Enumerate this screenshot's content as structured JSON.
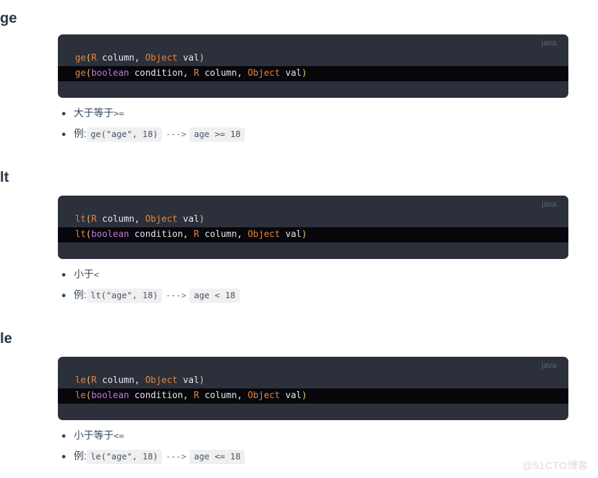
{
  "page": {
    "background": "#ffffff",
    "watermark": "@51CTO博客",
    "code_theme": {
      "block_bg": "#2b303b",
      "highlight_bg": "#07070b",
      "lang_label_color": "#5c6673",
      "fn_color": "#e8833a",
      "punct_color": "#e5c07b",
      "type_color": "#e8833a",
      "keyword_color": "#c678dd",
      "plain_color": "#e6e9ef"
    },
    "heading_color": "#243746",
    "bullet_text_color": "#34495e",
    "inline_code_bg": "#f0f0f0",
    "inline_code_color": "#44546a"
  },
  "sections": [
    {
      "heading": "ge",
      "code": {
        "lang_label": "java",
        "lines": [
          {
            "highlighted": false,
            "tokens": [
              {
                "text": "ge",
                "type": "fn"
              },
              {
                "text": "(",
                "type": "punct"
              },
              {
                "text": "R",
                "type": "type"
              },
              {
                "text": " column, ",
                "type": "plain"
              },
              {
                "text": "Object",
                "type": "type"
              },
              {
                "text": " val",
                "type": "plain"
              },
              {
                "text": ")",
                "type": "punct"
              }
            ]
          },
          {
            "highlighted": true,
            "tokens": [
              {
                "text": "ge",
                "type": "fn"
              },
              {
                "text": "(",
                "type": "punct"
              },
              {
                "text": "boolean",
                "type": "kw"
              },
              {
                "text": " condition, ",
                "type": "plain"
              },
              {
                "text": "R",
                "type": "type"
              },
              {
                "text": " column, ",
                "type": "plain"
              },
              {
                "text": "Object",
                "type": "type"
              },
              {
                "text": " val",
                "type": "plain"
              },
              {
                "text": ")",
                "type": "punct"
              }
            ]
          }
        ]
      },
      "bullets": [
        {
          "parts": [
            {
              "kind": "text",
              "text": "大于等于 "
            },
            {
              "kind": "symbol",
              "text": ">="
            }
          ]
        },
        {
          "parts": [
            {
              "kind": "text",
              "text": "例: "
            },
            {
              "kind": "code",
              "text": "ge(\"age\", 18)"
            },
            {
              "kind": "arrow",
              "text": "--->"
            },
            {
              "kind": "code",
              "text": "age >= 18"
            }
          ]
        }
      ]
    },
    {
      "heading": "lt",
      "code": {
        "lang_label": "java",
        "lines": [
          {
            "highlighted": false,
            "tokens": [
              {
                "text": "lt",
                "type": "fn"
              },
              {
                "text": "(",
                "type": "punct"
              },
              {
                "text": "R",
                "type": "type"
              },
              {
                "text": " column, ",
                "type": "plain"
              },
              {
                "text": "Object",
                "type": "type"
              },
              {
                "text": " val",
                "type": "plain"
              },
              {
                "text": ")",
                "type": "punct"
              }
            ]
          },
          {
            "highlighted": true,
            "tokens": [
              {
                "text": "lt",
                "type": "fn"
              },
              {
                "text": "(",
                "type": "punct"
              },
              {
                "text": "boolean",
                "type": "kw"
              },
              {
                "text": " condition, ",
                "type": "plain"
              },
              {
                "text": "R",
                "type": "type"
              },
              {
                "text": " column, ",
                "type": "plain"
              },
              {
                "text": "Object",
                "type": "type"
              },
              {
                "text": " val",
                "type": "plain"
              },
              {
                "text": ")",
                "type": "punct"
              }
            ]
          }
        ]
      },
      "bullets": [
        {
          "parts": [
            {
              "kind": "text",
              "text": "小于 "
            },
            {
              "kind": "symbol",
              "text": "<"
            }
          ]
        },
        {
          "parts": [
            {
              "kind": "text",
              "text": "例: "
            },
            {
              "kind": "code",
              "text": "lt(\"age\", 18)"
            },
            {
              "kind": "arrow",
              "text": "--->"
            },
            {
              "kind": "code",
              "text": "age < 18"
            }
          ]
        }
      ]
    },
    {
      "heading": "le",
      "code": {
        "lang_label": "java",
        "lines": [
          {
            "highlighted": false,
            "tokens": [
              {
                "text": "le",
                "type": "fn"
              },
              {
                "text": "(",
                "type": "punct"
              },
              {
                "text": "R",
                "type": "type"
              },
              {
                "text": " column, ",
                "type": "plain"
              },
              {
                "text": "Object",
                "type": "type"
              },
              {
                "text": " val",
                "type": "plain"
              },
              {
                "text": ")",
                "type": "punct"
              }
            ]
          },
          {
            "highlighted": true,
            "tokens": [
              {
                "text": "le",
                "type": "fn"
              },
              {
                "text": "(",
                "type": "punct"
              },
              {
                "text": "boolean",
                "type": "kw"
              },
              {
                "text": " condition, ",
                "type": "plain"
              },
              {
                "text": "R",
                "type": "type"
              },
              {
                "text": " column, ",
                "type": "plain"
              },
              {
                "text": "Object",
                "type": "type"
              },
              {
                "text": " val",
                "type": "plain"
              },
              {
                "text": ")",
                "type": "punct"
              }
            ]
          }
        ]
      },
      "bullets": [
        {
          "parts": [
            {
              "kind": "text",
              "text": "小于等于 "
            },
            {
              "kind": "symbol",
              "text": "<="
            }
          ]
        },
        {
          "parts": [
            {
              "kind": "text",
              "text": "例: "
            },
            {
              "kind": "code",
              "text": "le(\"age\", 18)"
            },
            {
              "kind": "arrow",
              "text": "--->"
            },
            {
              "kind": "code",
              "text": "age <= 18"
            }
          ]
        }
      ]
    }
  ]
}
